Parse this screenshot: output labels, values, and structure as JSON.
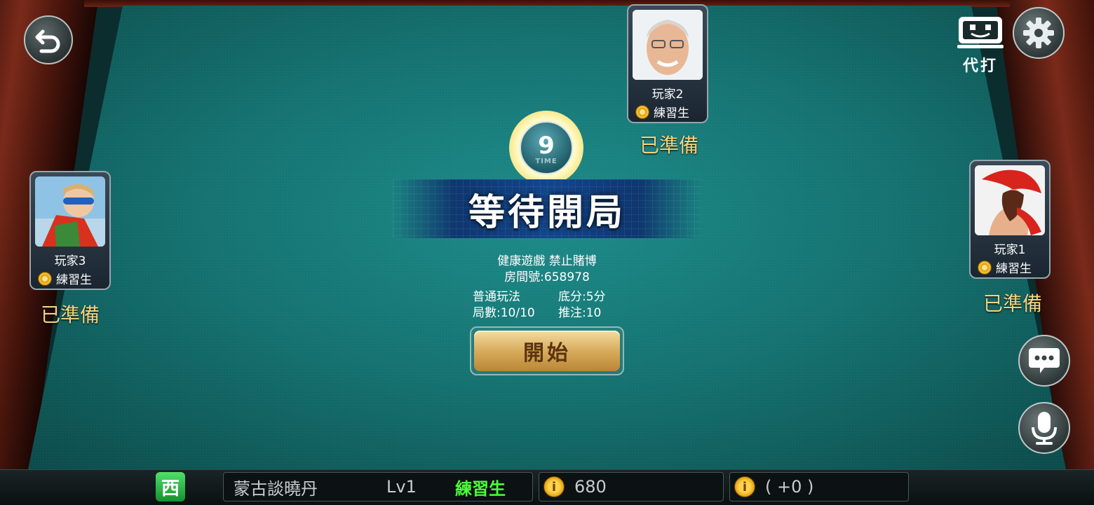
{
  "top_bar": {
    "auto_play_label": "代打"
  },
  "status": {
    "timer_value": "9",
    "timer_label": "TIME",
    "banner": "等待開局"
  },
  "room_info": {
    "line1": "健康遊戲 禁止賭博",
    "room_number": "房間號:658978",
    "mode": "普通玩法",
    "base_score": "底分:5分",
    "rounds": "局數:10/10",
    "bet": "推注:10"
  },
  "start_button_label": "開始",
  "players": [
    {
      "name": "玩家2",
      "rank": "練習生",
      "status": "已準備"
    },
    {
      "name": "玩家3",
      "rank": "練習生",
      "status": "已準備"
    },
    {
      "name": "玩家1",
      "rank": "練習生",
      "status": "已準備"
    }
  ],
  "self": {
    "seat": "西",
    "name": "蒙古談曉丹",
    "level": "Lv1",
    "rank": "練習生",
    "coins": "680",
    "coin_delta": "( +0 )"
  },
  "colors": {
    "felt": "#157472",
    "ready_text": "#f4d37d",
    "rank_green": "#4cff3a",
    "start_button": "#d8ac5c"
  }
}
